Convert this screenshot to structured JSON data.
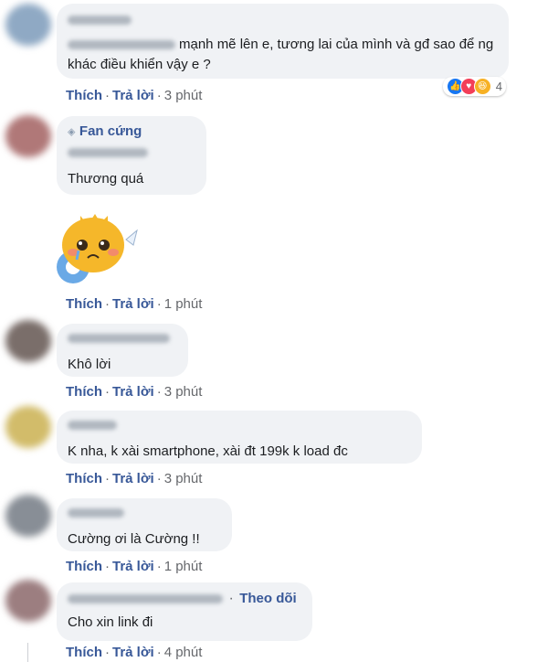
{
  "colors": {
    "accent": "#385898",
    "bubble": "#f0f2f5",
    "muted": "#65676b"
  },
  "actions": {
    "like": "Thích",
    "reply": "Trả lời",
    "sep": "·"
  },
  "comments": [
    {
      "text": "mạnh mẽ lên e, tương lai của mình và gđ sao để ng khác điều khiển vậy e ?",
      "time": "3 phút",
      "reaction_count": "4"
    },
    {
      "badge": "Fan cứng",
      "text": "Thương quá",
      "time": "1 phút"
    },
    {
      "text": "Khô lời",
      "time": "3 phút"
    },
    {
      "text": "K nha, k xài smartphone, xài đt 199k k load đc",
      "time": "3 phút"
    },
    {
      "text": "Cường ơi là Cường !!",
      "time": "1 phút"
    },
    {
      "follow": "Theo dõi",
      "text": "Cho xin link đi",
      "time": "4 phút"
    }
  ]
}
